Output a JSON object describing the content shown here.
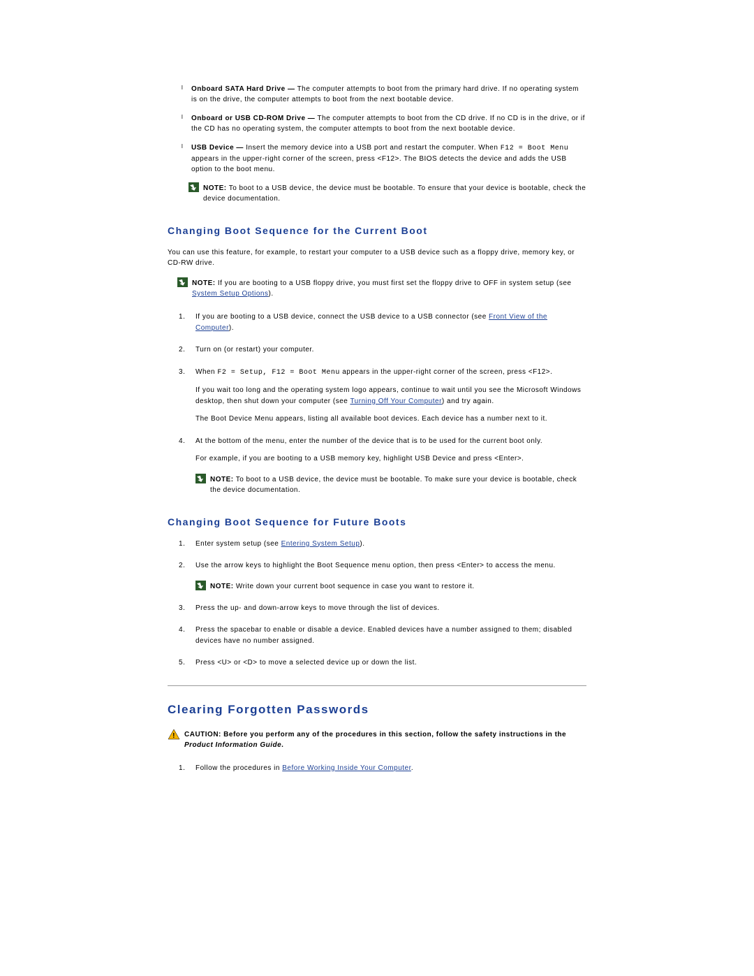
{
  "bullets": [
    {
      "label": "Onboard SATA Hard Drive —",
      "text": "The computer attempts to boot from the primary hard drive. If no operating system is on the drive, the computer attempts to boot from the next bootable device."
    },
    {
      "label": "Onboard or USB CD-ROM Drive —",
      "text": "The computer attempts to boot from the CD drive. If no CD is in the drive, or if the CD has no operating system, the computer attempts to boot from the next bootable device."
    },
    {
      "label": "USB Device —",
      "pre": "Insert the memory device into a USB port and restart the computer. When ",
      "code": "F12 = Boot Menu",
      "post": " appears in the upper-right corner of the screen, press <F12>. The BIOS detects the device and adds the USB option to the boot menu."
    }
  ],
  "note1": {
    "label": "NOTE:",
    "text": " To boot to a USB device, the device must be bootable. To ensure that your device is bootable, check the device documentation."
  },
  "sectionA": {
    "title": "Changing Boot Sequence for the Current Boot",
    "intro": "You can use this feature, for example, to restart your computer to a USB device such as a floppy drive, memory key, or CD-RW drive.",
    "note": {
      "label": "NOTE:",
      "pre": " If you are booting to a USB floppy drive, you must first set the floppy drive to OFF in system setup (see ",
      "link": "System Setup Options",
      "post": ")."
    },
    "steps": {
      "s1": {
        "pre": "If you are booting to a USB device, connect the USB device to a USB connector (see ",
        "link": "Front View of the Computer",
        "post": ")."
      },
      "s2": "Turn on (or restart) your computer.",
      "s3": {
        "pre": "When ",
        "code": "F2 = Setup, F12 = Boot Menu",
        "post": " appears in the upper-right corner of the screen, press <F12>.",
        "p1pre": "If you wait too long and the operating system logo appears, continue to wait until you see the Microsoft Windows desktop, then shut down your computer (see ",
        "p1link": "Turning Off Your Computer",
        "p1post": ") and try again.",
        "p2": "The Boot Device Menu appears, listing all available boot devices. Each device has a number next to it."
      },
      "s4": {
        "line": "At the bottom of the menu, enter the number of the device that is to be used for the current boot only.",
        "p1": "For example, if you are booting to a USB memory key, highlight USB Device and press <Enter>."
      }
    },
    "note2": {
      "label": "NOTE:",
      "text": " To boot to a USB device, the device must be bootable. To make sure your device is bootable, check the device documentation."
    }
  },
  "sectionB": {
    "title": "Changing Boot Sequence for Future Boots",
    "steps": {
      "s1": {
        "pre": "Enter system setup (see ",
        "link": "Entering System Setup",
        "post": ")."
      },
      "s2": "Use the arrow keys to highlight the Boot Sequence menu option, then press <Enter> to access the menu.",
      "note": {
        "label": "NOTE:",
        "text": " Write down your current boot sequence in case you want to restore it."
      },
      "s3": "Press the up- and down-arrow keys to move through the list of devices.",
      "s4": "Press the spacebar to enable or disable a device. Enabled devices have a number assigned to them; disabled devices have no number assigned.",
      "s5": "Press <U> or <D> to move a selected device up or down the list."
    }
  },
  "sectionC": {
    "title": "Clearing Forgotten Passwords",
    "caution": {
      "label": "CAUTION:",
      "pre": " Before you perform any of the procedures in this section, follow the safety instructions in the ",
      "italic": "Product Information Guide",
      "post": "."
    },
    "step1": {
      "pre": "Follow the procedures in ",
      "link": "Before Working Inside Your Computer",
      "post": "."
    }
  }
}
